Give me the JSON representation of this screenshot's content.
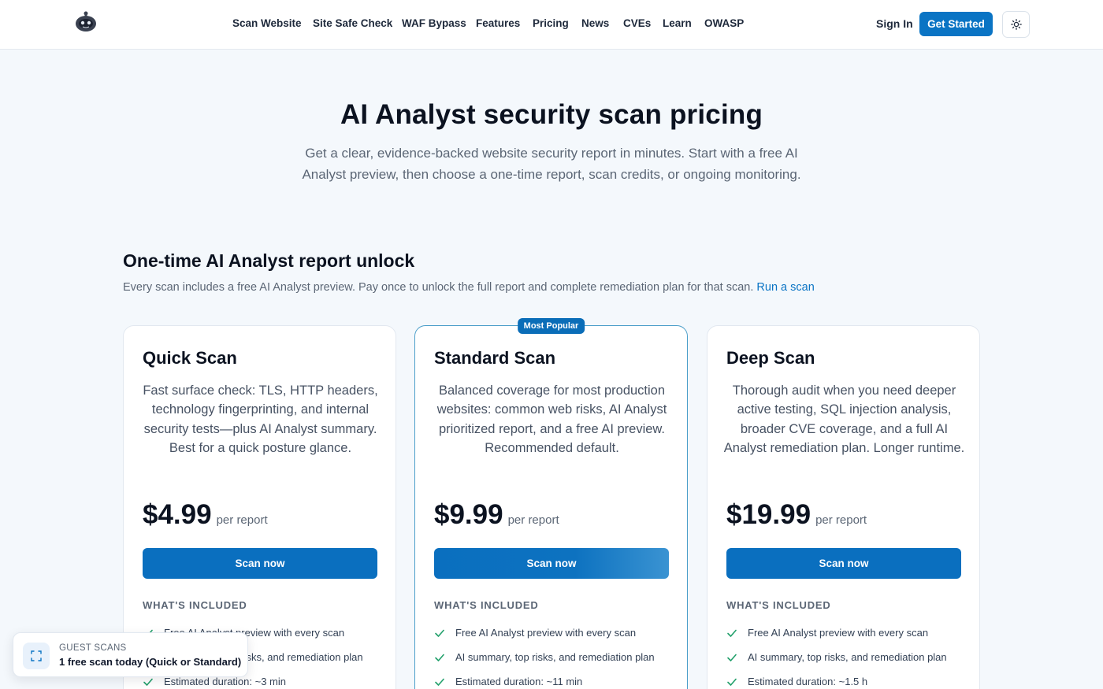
{
  "nav": {
    "items": [
      "Scan Website",
      "Site Safe Check",
      "WAF Bypass",
      "Features",
      "Pricing",
      "News",
      "CVEs",
      "Learn",
      "OWASP"
    ],
    "sign_in": "Sign In",
    "get_started": "Get Started"
  },
  "hero": {
    "title": "AI Analyst security scan pricing",
    "subtitle": "Get a clear, evidence-backed website security report in minutes. Start with a free AI Analyst preview, then choose a one-time report, scan credits, or ongoing monitoring."
  },
  "section": {
    "title": "One-time AI Analyst report unlock",
    "subtitle": "Every scan includes a free AI Analyst preview. Pay once to unlock the full report and complete remediation plan for that scan.",
    "link": "Run a scan"
  },
  "plans": [
    {
      "name": "Quick Scan",
      "description": "Fast surface check: TLS, HTTP headers, technology fingerprinting, and internal security tests—plus AI Analyst summary. Best for a quick posture glance.",
      "price": "$4.99",
      "per": "per report",
      "button": "Scan now",
      "included_label": "WHAT'S INCLUDED",
      "features": [
        "Free AI Analyst preview with every scan",
        "AI summary, top risks, and remediation plan",
        "Estimated duration: ~3 min"
      ]
    },
    {
      "name": "Standard Scan",
      "badge": "Most Popular",
      "description": "Balanced coverage for most production websites: common web risks, AI Analyst prioritized report, and a free AI preview. Recommended default.",
      "price": "$9.99",
      "per": "per report",
      "button": "Scan now",
      "included_label": "WHAT'S INCLUDED",
      "features": [
        "Free AI Analyst preview with every scan",
        "AI summary, top risks, and remediation plan",
        "Estimated duration: ~11 min"
      ]
    },
    {
      "name": "Deep Scan",
      "description": "Thorough audit when you need deeper active testing, SQL injection analysis, broader CVE coverage, and a full AI Analyst remediation plan. Longer runtime.",
      "price": "$19.99",
      "per": "per report",
      "button": "Scan now",
      "included_label": "WHAT'S INCLUDED",
      "features": [
        "Free AI Analyst preview with every scan",
        "AI summary, top risks, and remediation plan",
        "Estimated duration: ~1.5 h"
      ]
    }
  ],
  "guest": {
    "label": "GUEST SCANS",
    "text": "1 free scan today (Quick or Standard)"
  },
  "colors": {
    "accent": "#0a74c4",
    "check": "#22a06b",
    "background": "#f4f8fc"
  },
  "icons": {
    "logo": "robot-logo-icon",
    "theme": "sun-icon",
    "check": "check-icon",
    "scan": "scan-frame-icon"
  }
}
